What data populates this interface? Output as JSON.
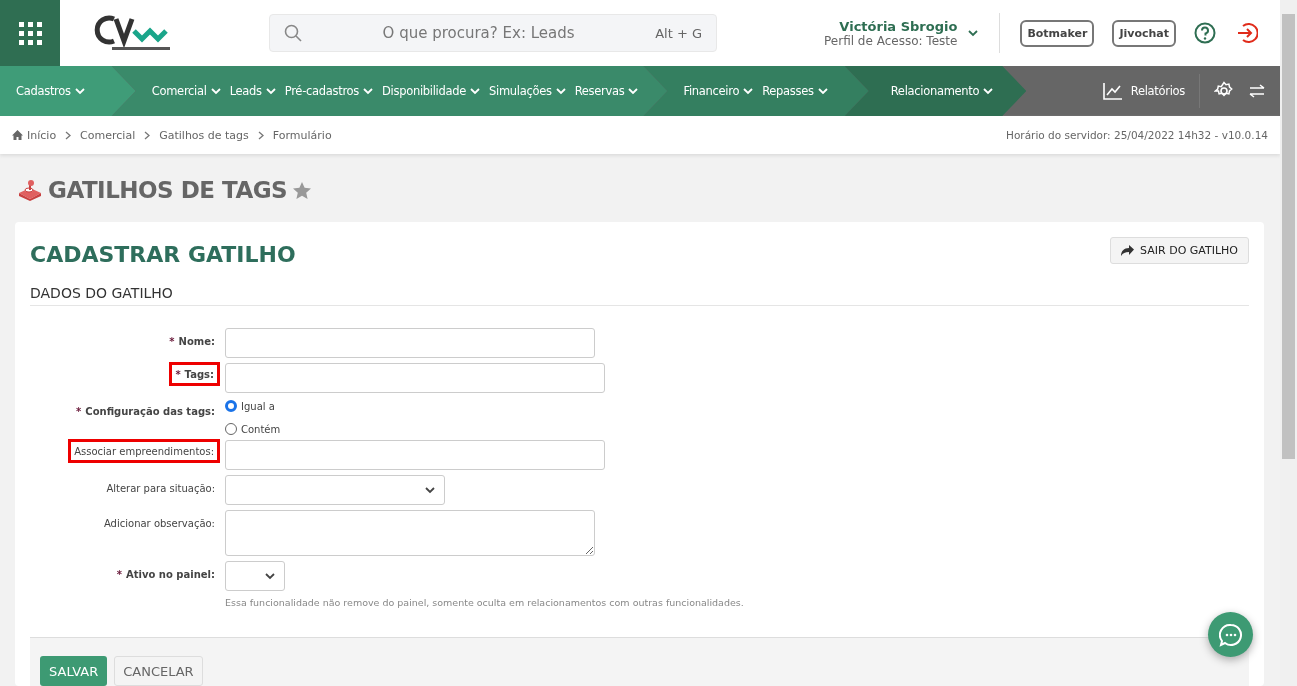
{
  "header": {
    "search": {
      "placeholder": "O que procura? Ex: Leads",
      "shortcut": "Alt + G"
    },
    "user": {
      "name": "Victória Sbrogio",
      "profile": "Perfil de Acesso: Teste"
    },
    "buttons": [
      "Botmaker",
      "Jivochat"
    ]
  },
  "nav": {
    "groups": [
      {
        "color": "#3f9c78",
        "items": [
          "Cadastros"
        ]
      },
      {
        "color": "#3a8a6a",
        "items": [
          "Comercial",
          "Leads",
          "Pré-cadastros",
          "Disponibilidade",
          "Simulações",
          "Reservas"
        ]
      },
      {
        "color": "#347f60",
        "items": [
          "Financeiro",
          "Repasses"
        ]
      },
      {
        "color": "#2e6e52",
        "items": [
          "Relacionamento"
        ]
      }
    ],
    "reports": "Relatórios"
  },
  "breadcrumb": [
    "Início",
    "Comercial",
    "Gatilhos de tags",
    "Formulário"
  ],
  "server_time": "Horário do servidor: 25/04/2022 14h32 - v10.0.14",
  "page_title": "GATILHOS DE TAGS",
  "card": {
    "title": "CADASTRAR GATILHO",
    "exit_button": "SAIR DO GATILHO",
    "section": "DADOS DO GATILHO",
    "fields": [
      {
        "kind": "text",
        "required_mark": "*",
        "label": "Nome:",
        "highlighted": false
      },
      {
        "kind": "text",
        "required_mark": "*",
        "label": "Tags:",
        "highlighted": true
      },
      {
        "kind": "radio",
        "required_mark": "*",
        "label": "Configuração das tags:",
        "highlighted": false,
        "options": [
          {
            "label": "Igual a",
            "selected": true
          },
          {
            "label": "Contém",
            "selected": false
          }
        ]
      },
      {
        "kind": "text",
        "label": "Associar empreendimentos:",
        "highlighted": true
      },
      {
        "kind": "select",
        "label": "Alterar para situação:",
        "highlighted": false
      },
      {
        "kind": "textarea",
        "label": "Adicionar observação:",
        "highlighted": false
      },
      {
        "kind": "select",
        "required_mark": "*",
        "label": "Ativo no painel:",
        "highlighted": false,
        "help": "Essa funcionalidade não remove do painel, somente oculta em relacionamentos com outras funcionalidades."
      }
    ],
    "save": "SALVAR",
    "cancel": "CANCELAR"
  }
}
